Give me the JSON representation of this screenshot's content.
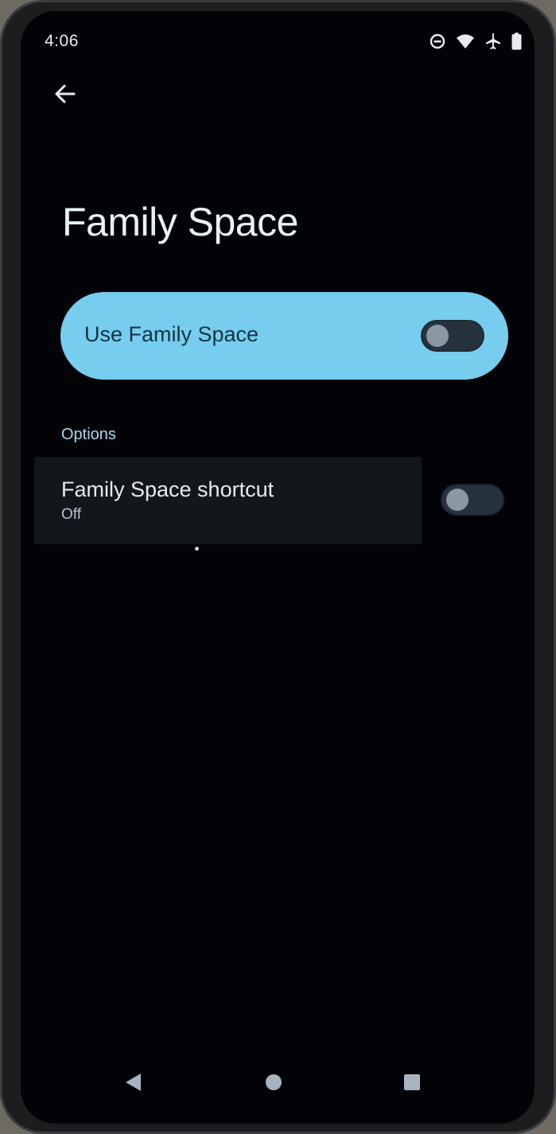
{
  "status_bar": {
    "time": "4:06",
    "icons": [
      "do-not-disturb-icon",
      "wifi-icon",
      "airplane-mode-icon",
      "battery-icon"
    ]
  },
  "header": {
    "back_icon": "arrow-back-icon",
    "title": "Family Space"
  },
  "main_switch": {
    "label": "Use Family Space",
    "enabled": false
  },
  "options": {
    "header": "Options",
    "items": [
      {
        "title": "Family Space shortcut",
        "summary": "Off",
        "enabled": false
      }
    ]
  },
  "nav_bar": {
    "icons": [
      "nav-back-icon",
      "nav-home-icon",
      "nav-recents-icon"
    ]
  },
  "colors": {
    "background": "#020306",
    "accent": "#77cdee",
    "section_header": "#a8d8ec",
    "text_primary": "#e8eaed",
    "toggle_track_off": "#26333d",
    "toggle_thumb_off": "#8a98a4"
  }
}
